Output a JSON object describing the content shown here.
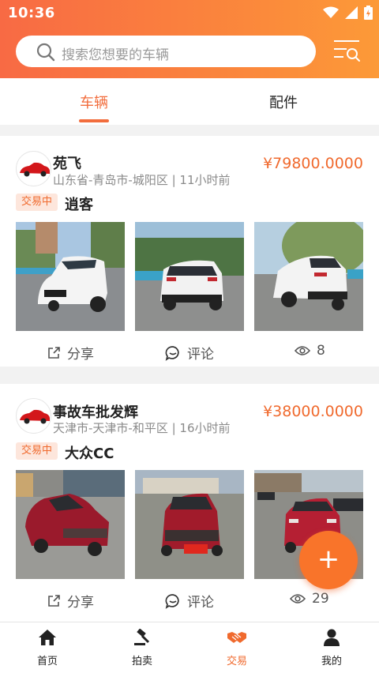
{
  "status": {
    "time": "10:36"
  },
  "search": {
    "placeholder": "搜索您想要的车辆"
  },
  "tabs": [
    {
      "label": "车辆",
      "active": true
    },
    {
      "label": "配件",
      "active": false
    }
  ],
  "listings": [
    {
      "seller": "苑飞",
      "location": "山东省-青岛市-城阳区 | 11小时前",
      "price": "¥79800.0000",
      "badge": "交易中",
      "model": "逍客",
      "share": "分享",
      "comment": "评论",
      "views": "8"
    },
    {
      "seller": "事故车批发辉",
      "location": "天津市-天津市-和平区 | 16小时前",
      "price": "¥38000.0000",
      "badge": "交易中",
      "model": "大众CC",
      "share": "分享",
      "comment": "评论",
      "views": "29"
    }
  ],
  "fab": {
    "label": "+"
  },
  "bottom_nav": [
    {
      "label": "首页",
      "icon": "home-icon"
    },
    {
      "label": "拍卖",
      "icon": "auction-gavel-icon"
    },
    {
      "label": "交易",
      "icon": "handshake-icon",
      "active": true
    },
    {
      "label": "我的",
      "icon": "person-icon"
    }
  ],
  "colors": {
    "accent": "#f06a2e",
    "header_start": "#f86a44",
    "header_end": "#fc9a38",
    "badge_bg": "#fde6dc"
  }
}
